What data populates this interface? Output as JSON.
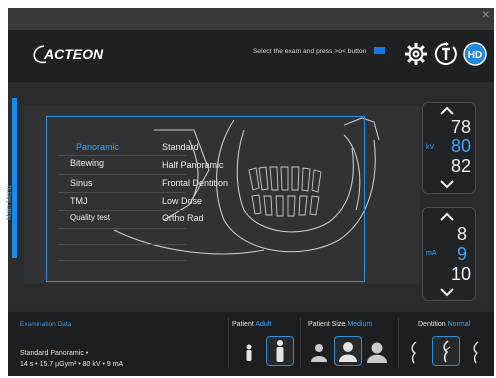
{
  "header": {
    "brand": "ACTEON",
    "instruction": "Select the exam and press >o< button",
    "hd_label": "HD"
  },
  "main_menu": {
    "label": "Main Menu",
    "exam_types": [
      "Panoramic",
      "Bitewing",
      "Sinus",
      "TMJ",
      "Quality test"
    ],
    "selected_exam_type": "Panoramic",
    "exam_variants": [
      "Standard",
      "Half Panoramic",
      "Frontal Dentition",
      "Low Dose",
      "Ortho Rad"
    ]
  },
  "kv": {
    "unit": "kV",
    "values": [
      "78",
      "80",
      "82"
    ],
    "selected": "80"
  },
  "ma": {
    "unit": "mA",
    "values": [
      "8",
      "9",
      "10"
    ],
    "selected": "9"
  },
  "footer": {
    "exam_data_label": "Examination Data",
    "exam_data_line1": "Standard Panoramic •",
    "exam_data_line2": "14 s • 15.7 µGym² • 80 kV • 9 mA",
    "patient": {
      "label": "Patient",
      "value": "Adult"
    },
    "patient_size": {
      "label": "Patient Size",
      "value": "Medium"
    },
    "dentition": {
      "label": "Dentition",
      "value": "Normal"
    }
  },
  "colors": {
    "accent": "#39a6ff",
    "background": "#2a2b2d",
    "text": "#eceff1"
  },
  "icons": [
    "close-icon",
    "settings-gear-icon",
    "timer-t-icon",
    "hd-icon",
    "chevron-up-icon",
    "chevron-down-icon",
    "child-icon",
    "adult-icon",
    "head-small-icon",
    "head-medium-icon",
    "head-large-icon",
    "tooth-icon"
  ]
}
